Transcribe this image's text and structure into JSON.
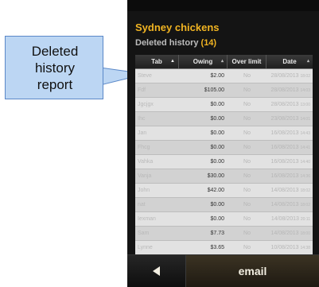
{
  "callout": {
    "lines": [
      "Deleted",
      "history",
      "report"
    ]
  },
  "app": {
    "title": "Sydney chickens",
    "subtitle": "Deleted history",
    "count": "(14)"
  },
  "table": {
    "headers": [
      "Tab",
      "Owing",
      "Over limit",
      "Date"
    ],
    "rows": [
      {
        "tab": "Steve",
        "owing": "$2.00",
        "over": "No",
        "date": "28/08/2013",
        "time": "18:02"
      },
      {
        "tab": "Fdf",
        "owing": "$105.00",
        "over": "No",
        "date": "28/08/2013",
        "time": "14:03"
      },
      {
        "tab": "Jgcjgx",
        "owing": "$0.00",
        "over": "No",
        "date": "28/08/2013",
        "time": "13:00"
      },
      {
        "tab": "Ihc",
        "owing": "$0.00",
        "over": "No",
        "date": "23/08/2013",
        "time": "14:01"
      },
      {
        "tab": "Jan",
        "owing": "$0.00",
        "over": "No",
        "date": "16/08/2013",
        "time": "14:43"
      },
      {
        "tab": "Fhcg",
        "owing": "$0.00",
        "over": "No",
        "date": "16/08/2013",
        "time": "14:41"
      },
      {
        "tab": "Vahka",
        "owing": "$0.00",
        "over": "No",
        "date": "16/08/2013",
        "time": "14:40"
      },
      {
        "tab": "Vanja",
        "owing": "$30.00",
        "over": "No",
        "date": "16/08/2013",
        "time": "14:36"
      },
      {
        "tab": "John",
        "owing": "$42.00",
        "over": "No",
        "date": "14/08/2013",
        "time": "18:02"
      },
      {
        "tab": "nat",
        "owing": "$0.00",
        "over": "No",
        "date": "14/08/2013",
        "time": "18:02"
      },
      {
        "tab": "Iexman",
        "owing": "$0.00",
        "over": "No",
        "date": "14/08/2013",
        "time": "20:11"
      },
      {
        "tab": "Sam",
        "owing": "$7.73",
        "over": "No",
        "date": "14/08/2013",
        "time": "18:00"
      },
      {
        "tab": "Lynne",
        "owing": "$3.65",
        "over": "No",
        "date": "10/08/2013",
        "time": "14:38"
      }
    ]
  },
  "toolbar": {
    "back_icon": "back-arrow-icon",
    "email_label": "email"
  }
}
